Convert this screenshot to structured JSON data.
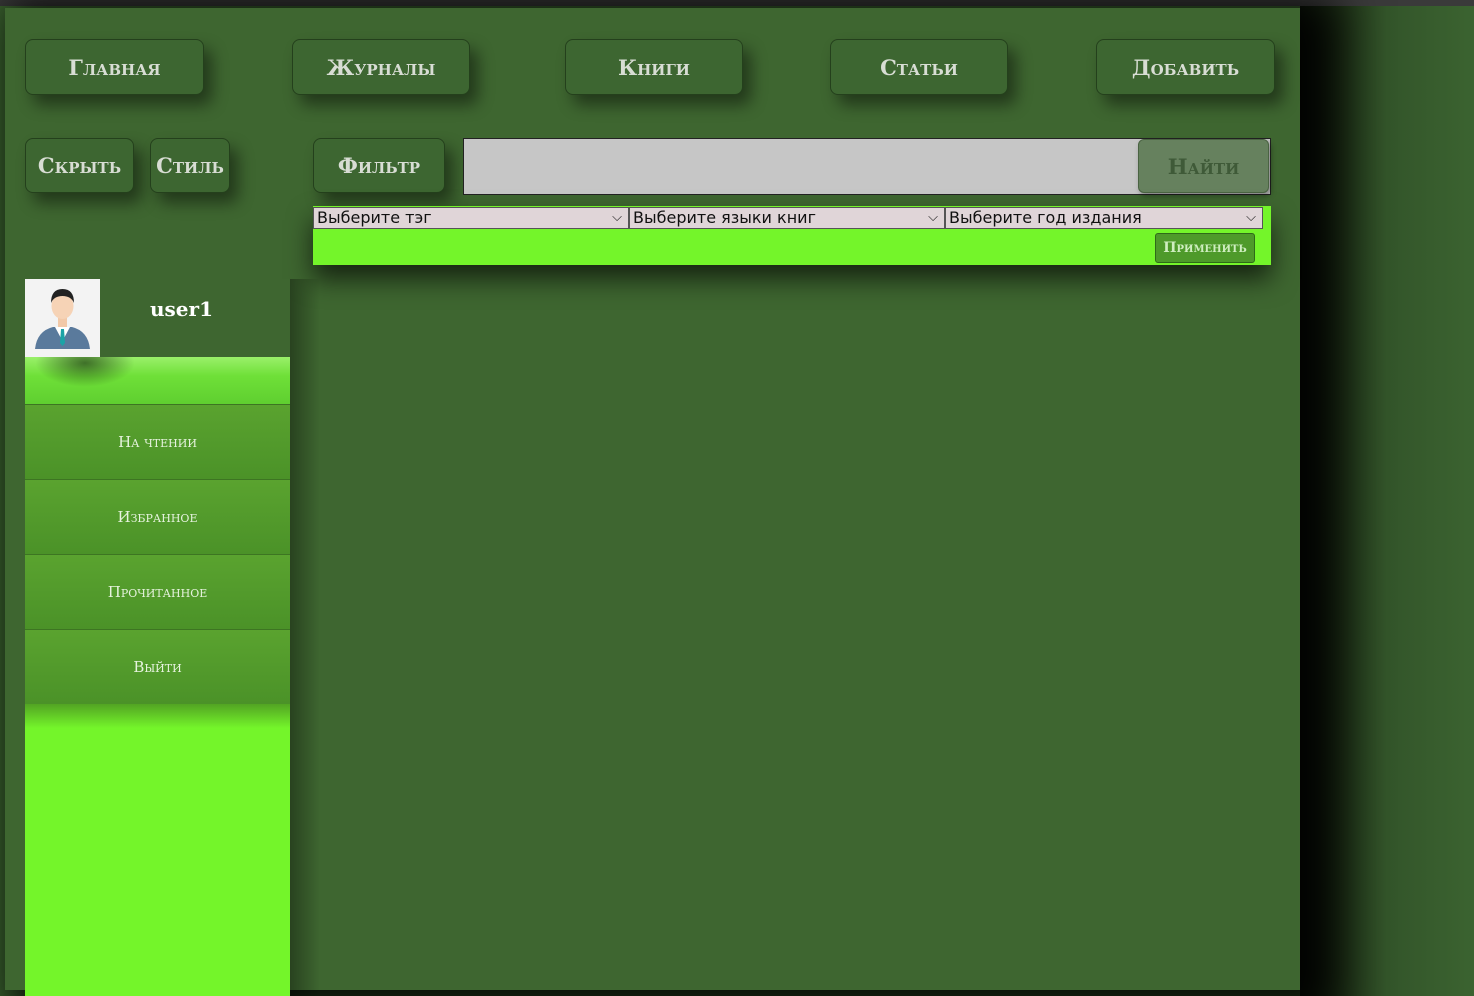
{
  "nav": {
    "home": "Главная",
    "journals": "Журналы",
    "books": "Книги",
    "articles": "Статьи",
    "add": "Добавить"
  },
  "toolbar": {
    "hide": "Скрыть",
    "style": "Стиль",
    "filter": "Фильтр"
  },
  "search": {
    "value": "",
    "button": "Найти"
  },
  "filters": {
    "tag": "Выберите тэг",
    "language": "Выберите языки книг",
    "year": "Выберите год издания",
    "apply": "Применить"
  },
  "profile": {
    "username": "user1"
  },
  "sidebar": {
    "items": [
      {
        "label": "На чтении"
      },
      {
        "label": "Избранное"
      },
      {
        "label": "Прочитанное"
      },
      {
        "label": "Выйти"
      }
    ]
  },
  "colors": {
    "background": "#3e6630",
    "accent": "#74f52a",
    "menu": "#54a02c"
  }
}
